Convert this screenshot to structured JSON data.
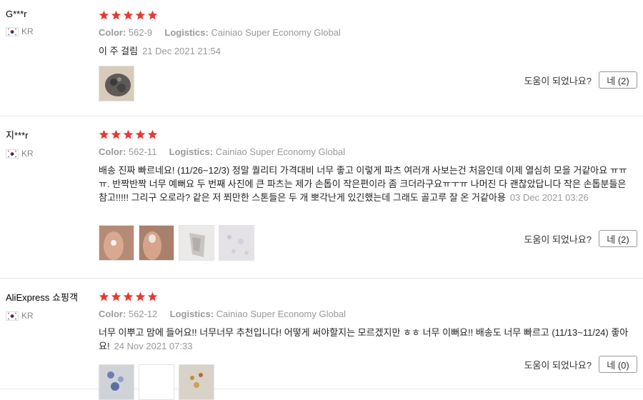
{
  "helpful_label": "도움이 되었나요?",
  "labels": {
    "color": "Color:",
    "logistics": "Logistics:"
  },
  "colors": {
    "star": "#e53935",
    "divider": "#e8e8e8"
  },
  "reviews": [
    {
      "user": "G***r",
      "country": "KR",
      "rating": 5,
      "color_value": "562-9",
      "logistics_value": "Cainiao Super Economy Global",
      "text": "이 주 걸림",
      "date": "21 Dec 2021 21:54",
      "thumbnail_count": 1,
      "helpful_button": "네 (2)"
    },
    {
      "user": "지***r",
      "country": "KR",
      "rating": 5,
      "color_value": "562-11",
      "logistics_value": "Cainiao Super Economy Global",
      "text": "배송 진짜 빠르네요! (11/26~12/3) 정말 퀄리티 가격대비 너무 좋고 이렇게 파츠 여러개 사보는건 처음인데 이제 열심히 모을 거같아요 ㅠㅠㅠ. 반짝반짝 너무 예뻐요 두 번째 사진에 큰 파츠는 제가 손톱이 작은편이라 좀 크더라구요ㅠㅜㅠ 나머진 다 괜찮았답니다 작은 손톱분들은 참고!!!!! 그리구 오로라? 같은 저 쬐만한 스톤들은 두 개 뽀각난게 있긴했는데 그래도 골고루 잘 온 거같아용",
      "date": "03 Dec 2021 03:26",
      "thumbnail_count": 4,
      "helpful_button": "네 (2)"
    },
    {
      "user": "AliExpress 쇼핑객",
      "country": "KR",
      "rating": 5,
      "color_value": "562-12",
      "logistics_value": "Cainiao Super Economy Global",
      "text": "너무 이뿌고 맘에 들어요!! 너무너무 추천입니다! 어떻게 써야할지는 모르겠지만 ㅎㅎ 너무 이뻐요!! 배송도 너무 빠르고 (11/13~11/24) 좋아요!",
      "date": "24 Nov 2021 07:33",
      "thumbnail_count": 3,
      "helpful_button": "네 (0)"
    }
  ]
}
